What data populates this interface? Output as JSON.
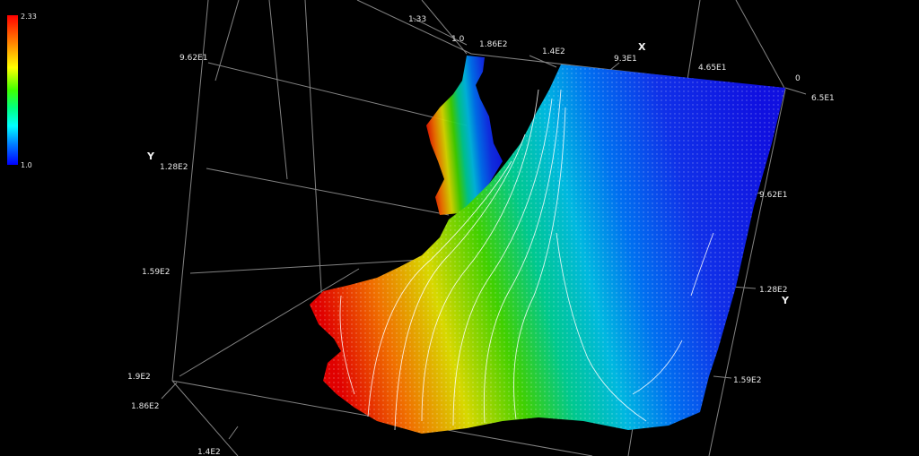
{
  "chart_data": {
    "type": "surface3d",
    "colorbar": {
      "max_label": "2.33",
      "min_label": "1.0",
      "max": 2.33,
      "min": 1.0
    },
    "colors": {
      "high": "#ff0000",
      "mid_high": "#ffff00",
      "mid": "#00ff00",
      "mid_low": "#00ffff",
      "low": "#0000ff"
    },
    "axes": {
      "x": {
        "title": "X",
        "ticks": [
          "1.86E2",
          "1.4E2",
          "9.3E1",
          "4.65E1",
          "0"
        ]
      },
      "y_right": {
        "title": "Y",
        "ticks": [
          "6.5E1",
          "9.62E1",
          "1.28E2",
          "1.59E2"
        ]
      },
      "y_left": {
        "title": "Y",
        "ticks": [
          "9.62E1",
          "1.28E2",
          "1.59E2",
          "1.9E2"
        ]
      },
      "z": {
        "ticks": [
          "1.33",
          "1.0"
        ]
      },
      "bottom_ticks": [
        "1.86E2",
        "1.4E2"
      ]
    }
  }
}
